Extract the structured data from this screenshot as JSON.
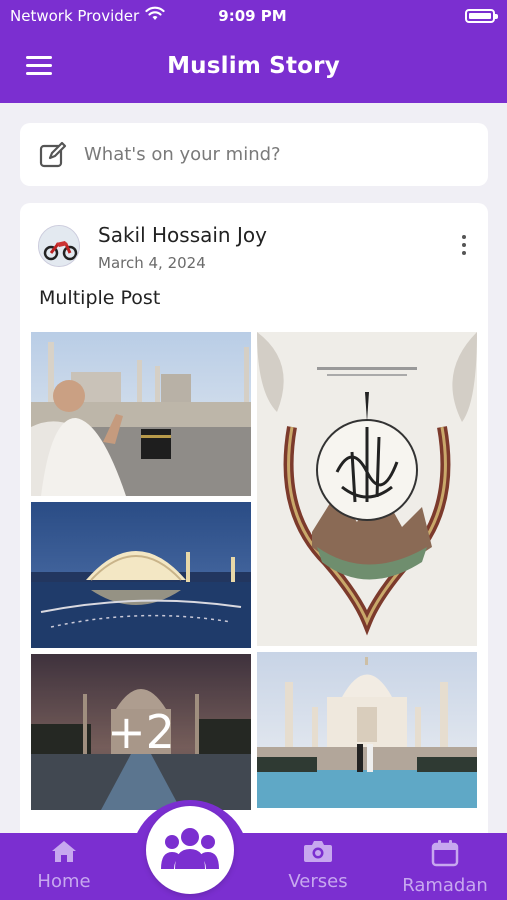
{
  "status_bar": {
    "carrier": "Network Provider",
    "time": "9:09 PM"
  },
  "app_bar": {
    "title": "Muslim Story"
  },
  "composer": {
    "placeholder": "What's on your mind?"
  },
  "post": {
    "author": "Sakil Hossain Joy",
    "date": "March 4, 2024",
    "text": "Multiple Post",
    "more_count": "+2",
    "photos": [
      {
        "subject": "Pilgrim praying at the Kaaba, Mecca"
      },
      {
        "subject": "Calligraphy artwork with mountains"
      },
      {
        "subject": "Illuminated dome building at night"
      },
      {
        "subject": "Taj Mahal at dusk"
      },
      {
        "subject": "Taj Mahal with couple"
      }
    ]
  },
  "bottom_nav": {
    "items": [
      {
        "label": "Home",
        "icon": "home-icon"
      },
      {
        "label": "Verses",
        "icon": "camera-icon"
      },
      {
        "label": "Ramadan",
        "icon": "calendar-icon"
      }
    ],
    "fab_icon": "community-icon"
  },
  "colors": {
    "brand": "#7b2fd0",
    "nav_inactive": "#c7a8ef",
    "background": "#f0eff5"
  }
}
